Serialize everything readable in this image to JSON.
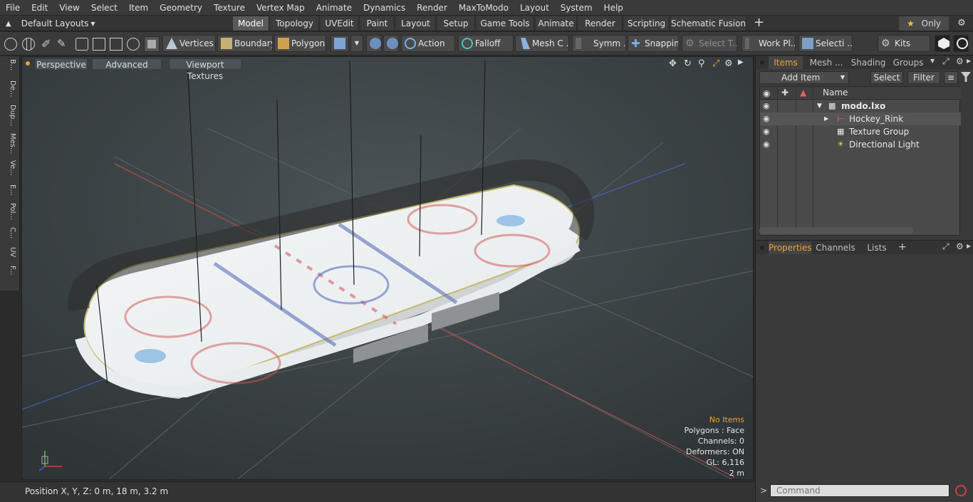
{
  "menu": [
    "File",
    "Edit",
    "View",
    "Select",
    "Item",
    "Geometry",
    "Texture",
    "Vertex Map",
    "Animate",
    "Dynamics",
    "Render",
    "MaxToModo",
    "Layout",
    "System",
    "Help"
  ],
  "layouts_label": "Default Layouts",
  "tabs": [
    {
      "label": "Model",
      "active": true
    },
    {
      "label": "Topology"
    },
    {
      "label": "UVEdit"
    },
    {
      "label": "Paint"
    },
    {
      "label": "Layout"
    },
    {
      "label": "Setup"
    },
    {
      "label": "Game Tools"
    },
    {
      "label": "Animate"
    },
    {
      "label": "Render"
    },
    {
      "label": "Scripting"
    },
    {
      "label": "Schematic Fusion"
    }
  ],
  "only_label": "Only",
  "toolbar": {
    "vertices": "Vertices",
    "boundary": "Boundary",
    "polygons": "Polygons",
    "action": "Action",
    "falloff": "Falloff",
    "mesh": "Mesh C ...",
    "symm": "Symm ...",
    "snapping": "Snapping",
    "select_t": "Select T...",
    "work_pl": "Work Pl...",
    "selecti": "Selecti ...",
    "kits": "Kits"
  },
  "left_tabs": [
    "B...",
    "De...",
    "Dup...",
    "Mes...",
    "Ve...",
    "E...",
    "Pol...",
    "C...",
    "UV",
    "F..."
  ],
  "viewport": {
    "perspective": "Perspective",
    "advanced": "Advanced",
    "textures": "Viewport Textures",
    "info": {
      "no_items": "No Items",
      "polygons": "Polygons : Face",
      "channels": "Channels: 0",
      "deformers": "Deformers: ON",
      "gl": "GL: 6,116",
      "scale": "2 m"
    }
  },
  "status": {
    "position": "Position X, Y, Z:  0 m, 18 m, 3.2 m"
  },
  "right": {
    "tabs": [
      "Items",
      "Mesh ...",
      "Shading",
      "Groups"
    ],
    "add_item": "Add Item",
    "select": "Select",
    "filter": "Filter",
    "col_name": "Name",
    "tree": [
      "modo.lxo",
      "Hockey_Rink",
      "Texture Group",
      "Directional Light"
    ],
    "prop_tabs": [
      "Properties",
      "Channels",
      "Lists"
    ],
    "command_placeholder": "Command"
  },
  "colors": {
    "accent": "#f0a030",
    "viewport_bg": "#424a4d"
  }
}
